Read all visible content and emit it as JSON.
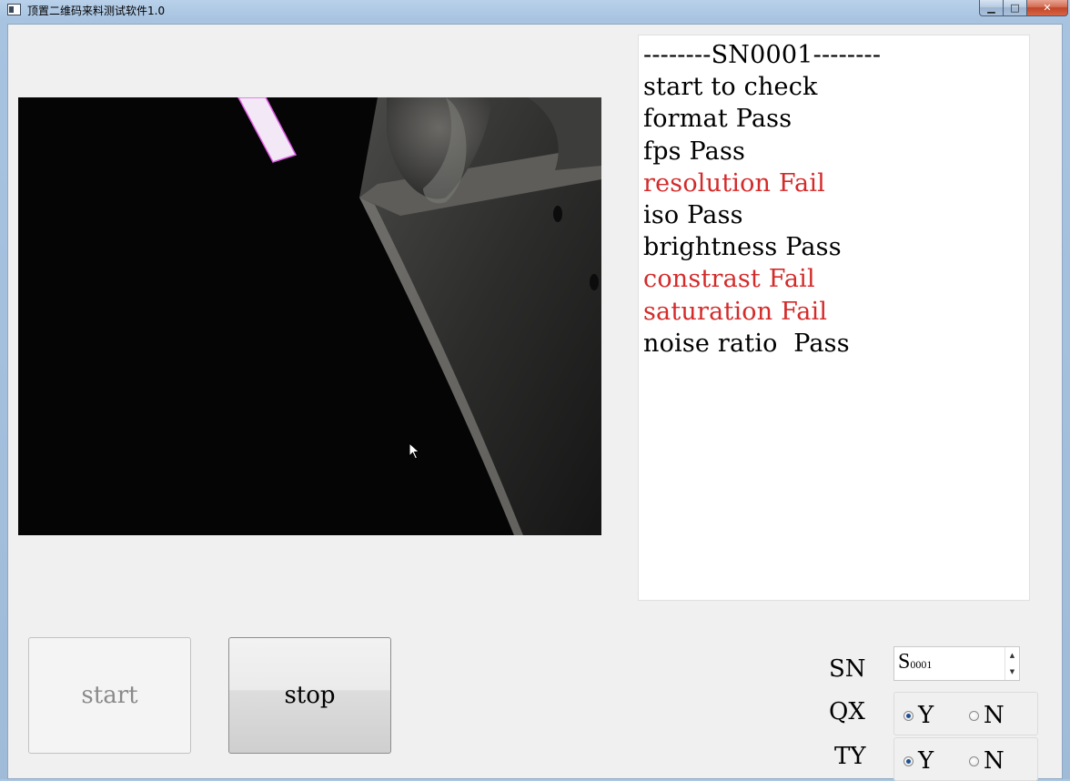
{
  "window": {
    "title": "顶置二维码来料测试软件1.0",
    "min_glyph": "▁",
    "max_glyph": "□",
    "close_glyph": "✕"
  },
  "log": {
    "lines": [
      {
        "text": "--------SN0001--------",
        "color": "#000000"
      },
      {
        "text": "start to check",
        "color": "#000000"
      },
      {
        "text": "format Pass",
        "color": "#000000"
      },
      {
        "text": "fps Pass",
        "color": "#000000"
      },
      {
        "text": "resolution Fail",
        "color": "#d42a2a"
      },
      {
        "text": "iso Pass",
        "color": "#000000"
      },
      {
        "text": "brightness Pass",
        "color": "#000000"
      },
      {
        "text": "constrast Fail",
        "color": "#d42a2a"
      },
      {
        "text": "saturation Fail",
        "color": "#d42a2a"
      },
      {
        "text": "noise ratio  Pass",
        "color": "#000000"
      }
    ]
  },
  "buttons": {
    "start_label": "start",
    "stop_label": "stop"
  },
  "fields": {
    "sn_label": "SN",
    "sn_value_big": "S",
    "sn_value_small": "0001",
    "qx_label": "QX",
    "ty_label": "TY",
    "qx_options": [
      {
        "label": "Y",
        "checked": true
      },
      {
        "label": "N",
        "checked": false
      }
    ],
    "ty_options": [
      {
        "label": "Y",
        "checked": true
      },
      {
        "label": "N",
        "checked": false
      }
    ]
  },
  "colors": {
    "pass": "#000000",
    "fail": "#d42a2a"
  }
}
